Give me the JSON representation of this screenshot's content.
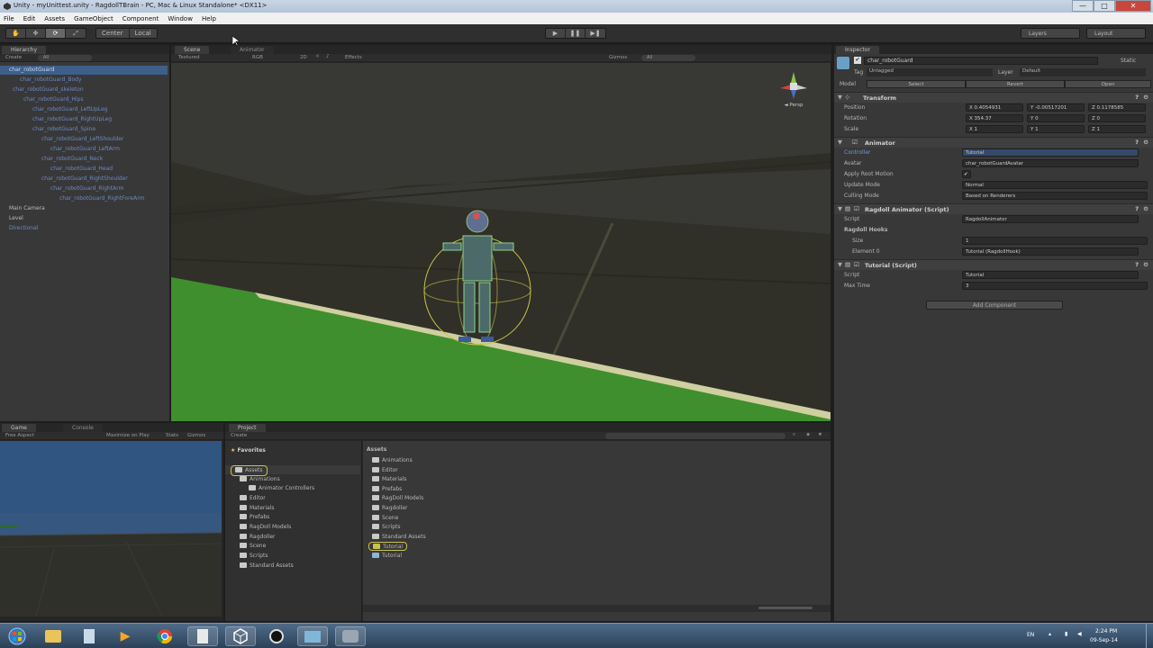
{
  "window": {
    "title": "Unity - myUnittest.unity - RagdollTBrain - PC, Mac & Linux Standalone* <DX11>",
    "controls": {
      "minimize": "—",
      "maximize": "□",
      "close": "✕"
    }
  },
  "menu": [
    "File",
    "Edit",
    "Assets",
    "GameObject",
    "Component",
    "Window",
    "Help"
  ],
  "toolbar": {
    "tools": [
      "hand-icon",
      "move-icon",
      "rotate-icon",
      "scale-icon"
    ],
    "pivot_label": "Center",
    "space_label": "Local",
    "play": "▶",
    "pause": "❚❚",
    "step": "▶❚",
    "layers_label": "Layers",
    "layout_label": "Layout"
  },
  "hierarchy": {
    "tab": "Hierarchy",
    "create_label": "Create",
    "search_placeholder": "All",
    "items": [
      {
        "label": "char_robotGuard",
        "selected": true
      },
      {
        "label": "char_robotGuard_Body"
      },
      {
        "label": "char_robotGuard_skeleton"
      },
      {
        "label": "char_robotGuard_Hips"
      },
      {
        "label": "char_robotGuard_LeftUpLeg"
      },
      {
        "label": "char_robotGuard_RightUpLeg"
      },
      {
        "label": "char_robotGuard_Spine"
      },
      {
        "label": "char_robotGuard_LeftShoulder"
      },
      {
        "label": "char_robotGuard_LeftArm"
      },
      {
        "label": "char_robotGuard_Neck"
      },
      {
        "label": "char_robotGuard_Head"
      },
      {
        "label": "char_robotGuard_RightShoulder"
      },
      {
        "label": "char_robotGuard_RightArm"
      },
      {
        "label": "char_robotGuard_RightForeArm"
      },
      {
        "label": "Main Camera"
      },
      {
        "label": "Level"
      },
      {
        "label": "Directional"
      }
    ]
  },
  "scene": {
    "tab": "Scene",
    "tab2": "Animator",
    "shading": "Textured",
    "mode": "RGB",
    "toggle_2d": "2D",
    "effects": "Effects",
    "gizmos": "Gizmos",
    "search_placeholder": "All",
    "gizmo_label": "◄ Persp"
  },
  "inspector": {
    "tab": "Inspector",
    "object_name": "char_robotGuard",
    "static_label": "Static",
    "tag_label": "Tag",
    "tag_value": "Untagged",
    "layer_label": "Layer",
    "layer_value": "Default",
    "model_label": "Model",
    "model_buttons": [
      "Select",
      "Revert",
      "Open"
    ],
    "transform": {
      "title": "Transform",
      "position_label": "Position",
      "rotation_label": "Rotation",
      "scale_label": "Scale",
      "position": [
        "0.4054931",
        "-0.00517201",
        "0.1178585"
      ],
      "rotation": [
        "354.37",
        "0",
        "0"
      ],
      "scale": [
        "1",
        "1",
        "1"
      ]
    },
    "animator": {
      "title": "Animator",
      "rows": [
        {
          "label": "Controller",
          "value": "Tutorial"
        },
        {
          "label": "Avatar",
          "value": "char_robotGuardAvatar"
        },
        {
          "label": "Apply Root Motion",
          "value": "✔"
        },
        {
          "label": "Update Mode",
          "value": "Normal"
        },
        {
          "label": "Culling Mode",
          "value": "Based on Renderers"
        }
      ]
    },
    "ragdoll": {
      "title": "Ragdoll Animator (Script)",
      "script_label": "Script",
      "script_value": "RagdollAnimator",
      "hooks_label": "Ragdoll Hooks",
      "size_label": "Size",
      "size_value": "1",
      "element_label": "Element 0",
      "element_value": "Tutorial (RagdollHook)"
    },
    "tutorial": {
      "title": "Tutorial (Script)",
      "script_label": "Script",
      "script_value": "Tutorial",
      "max_time_label": "Max Time",
      "max_time_value": "3"
    },
    "add_component": "Add Component"
  },
  "game": {
    "tab": "Game",
    "tab2": "Console",
    "aspect": "Free Aspect",
    "maximize": "Maximize on Play",
    "mute": "Stats",
    "gizmos": "Gizmos"
  },
  "project": {
    "tab": "Project",
    "create_label": "Create",
    "favorites": "Favorites",
    "assets_header": "Assets",
    "tree": [
      {
        "label": "Assets",
        "indent": 0,
        "highlight": true
      },
      {
        "label": "Animations",
        "indent": 1
      },
      {
        "label": "Animator Controllers",
        "indent": 2
      },
      {
        "label": "Editor",
        "indent": 1
      },
      {
        "label": "Materials",
        "indent": 1
      },
      {
        "label": "Prefabs",
        "indent": 1
      },
      {
        "label": "RagDoll Models",
        "indent": 1
      },
      {
        "label": "Ragdoller",
        "indent": 1
      },
      {
        "label": "Scene",
        "indent": 1
      },
      {
        "label": "Scripts",
        "indent": 1
      },
      {
        "label": "Standard Assets",
        "indent": 1
      }
    ],
    "assets": [
      {
        "label": "Animations"
      },
      {
        "label": "Editor"
      },
      {
        "label": "Materials"
      },
      {
        "label": "Prefabs"
      },
      {
        "label": "RagDoll Models"
      },
      {
        "label": "Ragdoller"
      },
      {
        "label": "Scene"
      },
      {
        "label": "Scripts"
      },
      {
        "label": "Standard Assets"
      },
      {
        "label": "Tutorial",
        "highlight": true
      },
      {
        "label": "Tutorial"
      }
    ]
  },
  "taskbar": {
    "apps": [
      "start-orb-icon",
      "explorer-icon",
      "notepad-icon",
      "media-player-icon",
      "chrome-icon",
      "documents-icon",
      "unity-icon",
      "unity-alt-icon",
      "photos-icon",
      "tool-icon"
    ],
    "tray_lang": "EN",
    "time": "2:24 PM",
    "date": "09-Sep-14"
  },
  "colors": {
    "panel_bg": "#383838",
    "selection": "#3e5f8a",
    "ground_green": "#3f8f2f",
    "accent_yellow": "#c9c24a"
  }
}
